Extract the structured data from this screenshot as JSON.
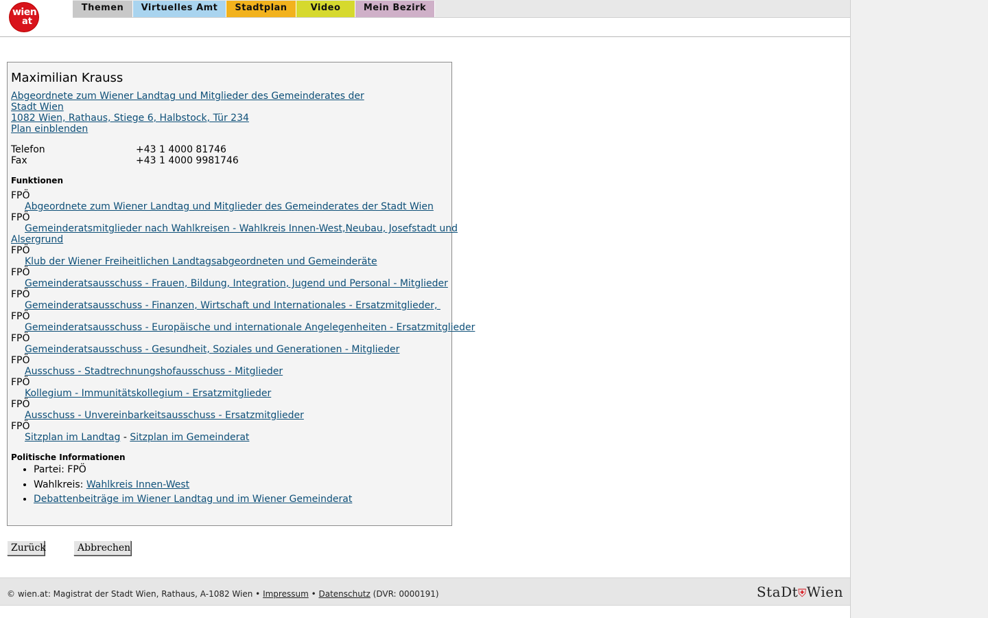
{
  "header": {
    "logo": "wien at",
    "tabs": [
      {
        "label": "Themen",
        "color": "#c8c8c8"
      },
      {
        "label": "Virtuelles Amt",
        "color": "#a9d4ef"
      },
      {
        "label": "Stadtplan",
        "color": "#f2b21d"
      },
      {
        "label": "Video",
        "color": "#d6d92e"
      },
      {
        "label": "Mein Bezirk",
        "color": "#cfb0c8"
      }
    ]
  },
  "person": {
    "name": "Maximilian Krauss",
    "affiliation_line1": "Abgeordnete zum Wiener Landtag und Mitglieder des Gemeinderates der",
    "affiliation_line2": "Stadt Wien",
    "address": "1082 Wien, Rathaus, Stiege 6, Halbstock, Tür 234",
    "plan_link": "Plan einblenden",
    "phone_label": "Telefon",
    "phone_value": "+43 1 4000 81746",
    "fax_label": "Fax",
    "fax_value": "+43 1 4000 9981746"
  },
  "functions": {
    "heading": "Funktionen",
    "party": "FPÖ",
    "items": [
      "Abgeordnete zum Wiener Landtag und Mitglieder des Gemeinderates der Stadt Wien",
      "Gemeinderatsmitglieder nach Wahlkreisen - Wahlkreis Innen-West,Neubau, Josefstadt und",
      "Alsergrund",
      "Klub der Wiener Freiheitlichen Landtagsabgeordneten und Gemeinderäte",
      "Gemeinderatsausschuss - Frauen, Bildung, Integration, Jugend und Personal - Mitglieder",
      "Gemeinderatsausschuss - Finanzen, Wirtschaft und Internationales - Ersatzmitglieder, ",
      "Gemeinderatsausschuss - Europäische und internationale Angelegenheiten - Ersatzmitglieder",
      "Gemeinderatsausschuss - Gesundheit, Soziales und Generationen - Mitglieder",
      "Ausschuss - Stadtrechnungshofausschuss - Mitglieder",
      "Kollegium - Immunitätskollegium - Ersatzmitglieder",
      "Ausschuss - Unvereinbarkeitsausschuss - Ersatzmitglieder"
    ],
    "seat_landtag": "Sitzplan im Landtag",
    "seat_sep": " - ",
    "seat_gemeinderat": "Sitzplan im Gemeinderat"
  },
  "political": {
    "heading": "Politische Informationen",
    "party_item": "Partei: FPÖ",
    "district_label": "Wahlkreis: ",
    "district_link": "Wahlkreis Innen-West",
    "debates_link": "Debattenbeiträge im Wiener Landtag und im Wiener Gemeinderat"
  },
  "buttons": {
    "back": "Zurück",
    "cancel": "Abbrechen"
  },
  "footer": {
    "copyright": "© wien.at: Magistrat der Stadt Wien, Rathaus, A-1082 Wien • ",
    "impressum": "Impressum",
    "sep": " • ",
    "datenschutz": "Datenschutz",
    "dvr": " (DVR: 0000191)",
    "stadt_logo_left": "StaDt",
    "stadt_logo_right": "Wien"
  }
}
